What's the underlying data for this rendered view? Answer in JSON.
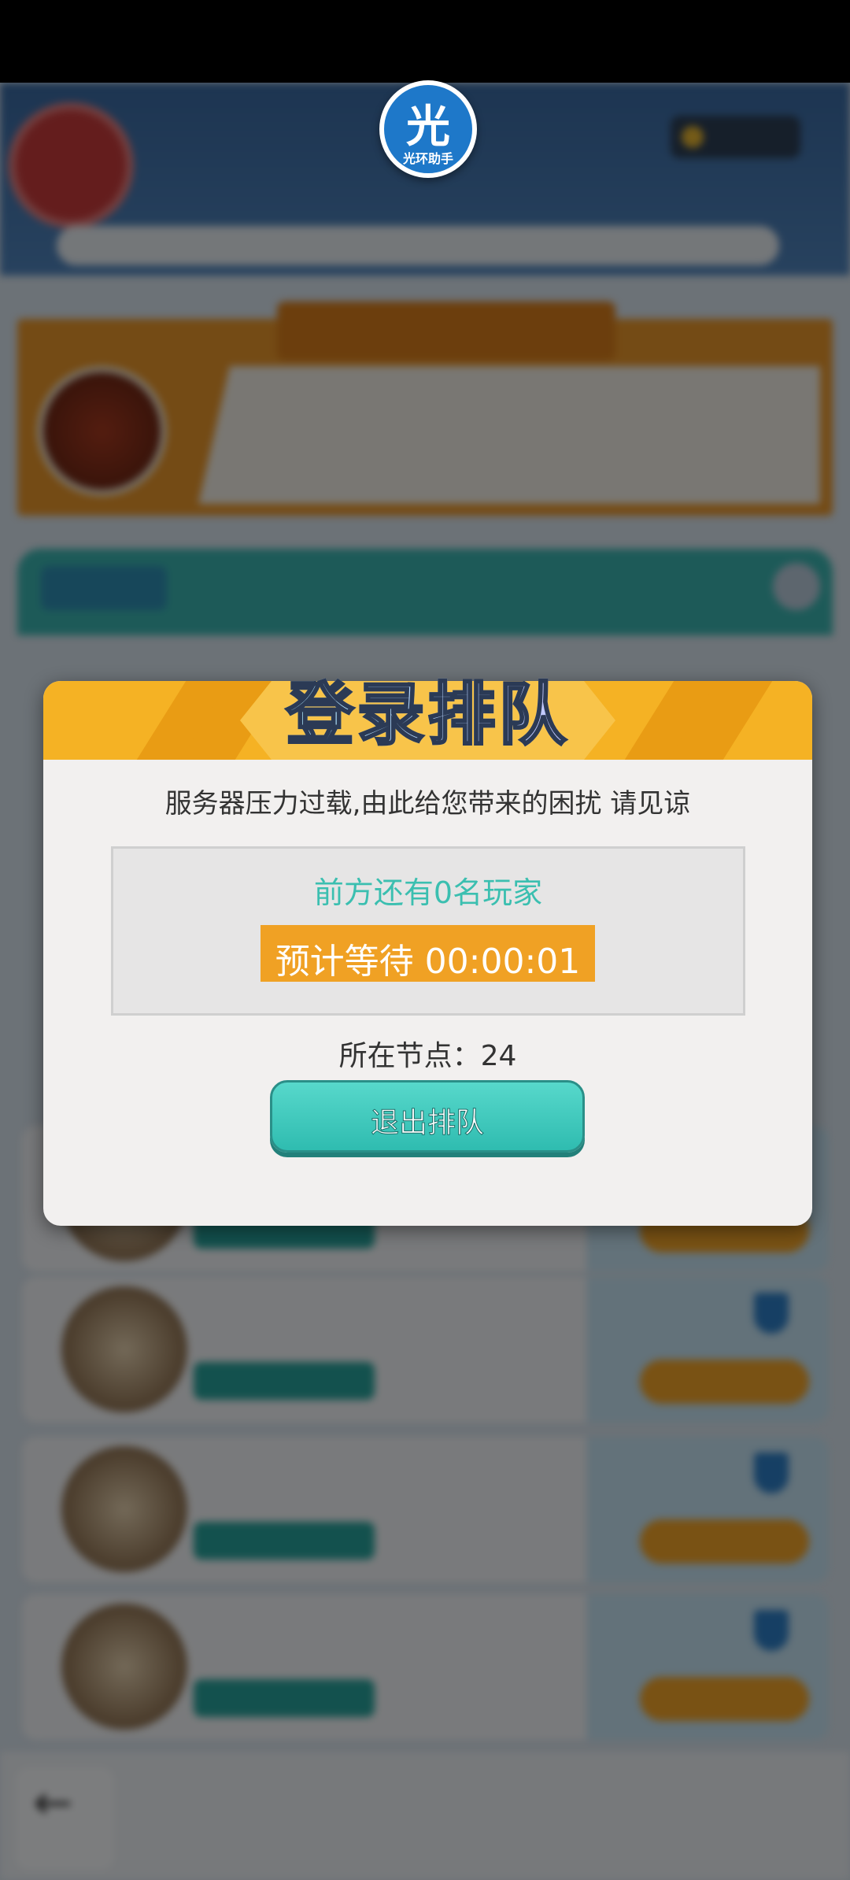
{
  "helper": {
    "char": "光",
    "label": "光环助手"
  },
  "background": {
    "seal_text": "",
    "coin_value": "",
    "rate_text": "",
    "promo_title": "",
    "promo_text": "",
    "list_tab": "",
    "cards": [
      {
        "name": "",
        "score": "",
        "battles": "",
        "gold": ""
      },
      {
        "name": "",
        "score": "",
        "battles": "",
        "gold": ""
      },
      {
        "name": "",
        "score": "",
        "battles": "",
        "gold": ""
      },
      {
        "name": "",
        "score": "",
        "battles": "",
        "gold": ""
      }
    ],
    "back_label": ""
  },
  "modal": {
    "title": "登录排队",
    "message": "服务器压力过载,由此给您带来的困扰 请见谅",
    "queue_ahead": "前方还有0名玩家",
    "wait": "预计等待 00:00:01",
    "node_line": "所在节点：24",
    "exit_label": "退出排队"
  },
  "colors": {
    "accent_orange": "#f5b224",
    "accent_teal": "#2fbcb0",
    "queue_text": "#3bbfb0"
  }
}
